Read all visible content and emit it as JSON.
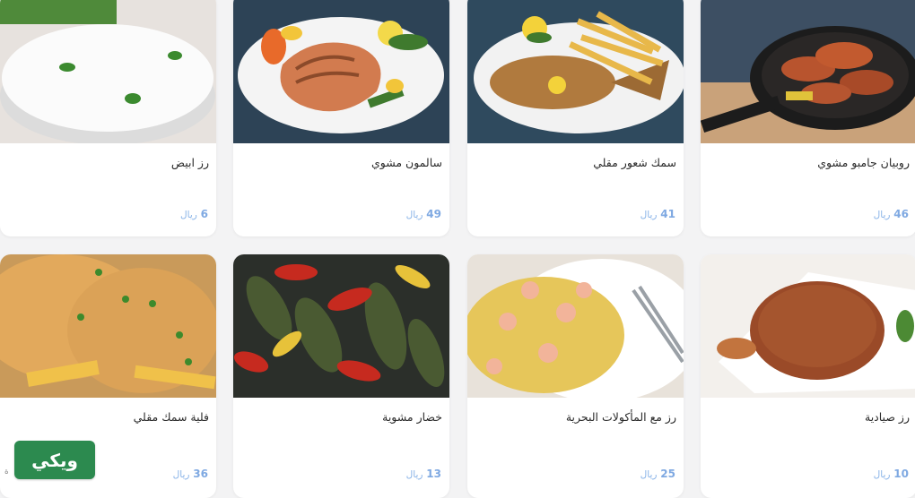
{
  "currency": "ريال",
  "items": [
    {
      "name": "روبيان جامبو مشوي",
      "price": "46"
    },
    {
      "name": "سمك شعور مقلي",
      "price": "41"
    },
    {
      "name": "سالمون مشوي",
      "price": "49"
    },
    {
      "name": "رز ابيض",
      "price": "6"
    },
    {
      "name": "رز صيادية",
      "price": "10"
    },
    {
      "name": "رز مع المأكولات البحرية",
      "price": "25"
    },
    {
      "name": "خضار مشوية",
      "price": "13"
    },
    {
      "name": "فلية سمك مقلي",
      "price": "36"
    }
  ],
  "logo": {
    "text": "ويكي"
  },
  "edge_mark": "ة"
}
